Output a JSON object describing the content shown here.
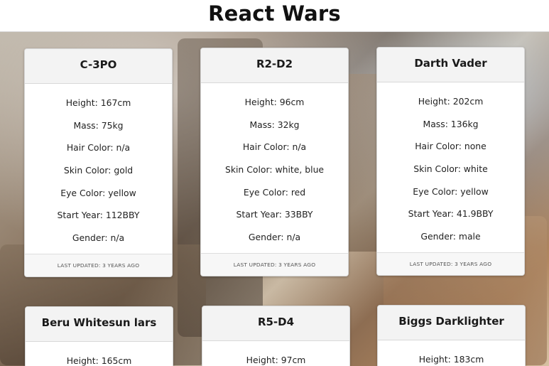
{
  "app": {
    "title": "React Wars"
  },
  "cards": [
    {
      "name": "C-3PO",
      "lines": [
        "Height: 167cm",
        "Mass: 75kg",
        "Hair Color: n/a",
        "Skin Color: gold",
        "Eye Color: yellow",
        "Start Year: 112BBY",
        "Gender: n/a"
      ],
      "footer": "LAST UPDATED: 3 YEARS AGO"
    },
    {
      "name": "R2-D2",
      "lines": [
        "Height: 96cm",
        "Mass: 32kg",
        "Hair Color: n/a",
        "Skin Color: white, blue",
        "Eye Color: red",
        "Start Year: 33BBY",
        "Gender: n/a"
      ],
      "footer": "LAST UPDATED: 3 YEARS AGO"
    },
    {
      "name": "Darth Vader",
      "lines": [
        "Height: 202cm",
        "Mass: 136kg",
        "Hair Color: none",
        "Skin Color: white",
        "Eye Color: yellow",
        "Start Year: 41.9BBY",
        "Gender: male"
      ],
      "footer": "LAST UPDATED: 3 YEARS AGO"
    },
    {
      "name": "Beru Whitesun lars",
      "lines": [
        "Height: 165cm"
      ]
    },
    {
      "name": "R5-D4",
      "lines": [
        "Height: 97cm"
      ]
    },
    {
      "name": "Biggs Darklighter",
      "lines": [
        "Height: 183cm"
      ]
    }
  ]
}
